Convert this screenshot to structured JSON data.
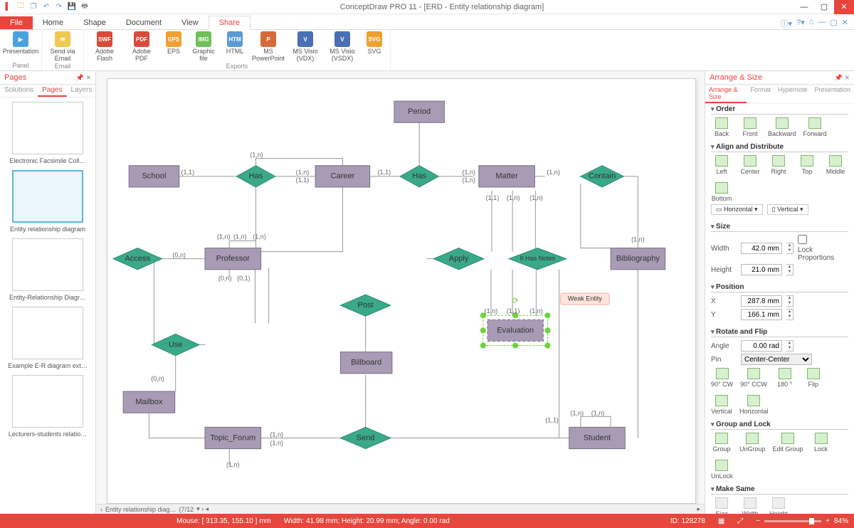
{
  "window": {
    "title": "ConceptDraw PRO 11 - [ERD - Entity relationship diagram]"
  },
  "ribbon": {
    "tabs": {
      "file": "File",
      "home": "Home",
      "shape": "Shape",
      "document": "Document",
      "view": "View",
      "share": "Share"
    },
    "groups": {
      "panel": {
        "label": "Panel",
        "presentation": "Presentation"
      },
      "email": {
        "label": "Email",
        "send": "Send via Email"
      },
      "exports": {
        "label": "Exports",
        "flash": "Adobe Flash",
        "pdf": "Adobe PDF",
        "eps": "EPS",
        "gfile": "Graphic file",
        "html": "HTML",
        "ppt": "MS PowerPoint",
        "vdx": "MS Visio (VDX)",
        "vsdx": "MS Visio (VSDX)",
        "svg": "SVG"
      }
    }
  },
  "pages_panel": {
    "title": "Pages",
    "tabs": {
      "solutions": "Solutions",
      "pages": "Pages",
      "layers": "Layers"
    },
    "thumbs": [
      "Electronic Facsimile Coll…",
      "Entity relationship diagram",
      "Entity-Relationship Diagr…",
      "Example E-R diagram ext…",
      "Lecturers-students relatio…"
    ]
  },
  "diagram": {
    "entities": {
      "period": "Period",
      "school": "School",
      "career": "Career",
      "matter": "Matter",
      "bibliography": "Bibliography",
      "professor": "Professor",
      "evaluation": "Evaluation",
      "billboard": "Billboard",
      "mailbox": "Mailbox",
      "topic_forum": "Topic_Forum",
      "student": "Student"
    },
    "relationships": {
      "has1": "Has",
      "has2": "Has",
      "contain": "Contain",
      "access": "Access",
      "apply": "Apply",
      "ithasnotes": "It Has Notes",
      "use": "Use",
      "post": "Post",
      "send": "Send"
    },
    "tooltip": "Weak Entity",
    "cardinalities": {
      "c11": "(1,1)",
      "c1n": "(1,n)",
      "c0n": "(0,n)",
      "c01": "(0,1)"
    }
  },
  "doc_tabs": {
    "page_label": "Entity relationship diag…",
    "page_counter": "(7/12"
  },
  "arrange": {
    "title": "Arrange & Size",
    "tabs": {
      "arrange": "Arrange & Size",
      "format": "Format",
      "hypernote": "Hypernote",
      "presentation": "Presentation"
    },
    "order": {
      "title": "Order",
      "back": "Back",
      "front": "Front",
      "backward": "Backward",
      "forward": "Forward"
    },
    "align": {
      "title": "Align and Distribute",
      "left": "Left",
      "center": "Center",
      "right": "Right",
      "top": "Top",
      "middle": "Middle",
      "bottom": "Bottom",
      "horizontal": "Horizontal",
      "vertical": "Vertical"
    },
    "size": {
      "title": "Size",
      "width_l": "Width",
      "height_l": "Height",
      "width": "42.0 mm",
      "height": "21.0 mm",
      "lock": "Lock Proportions"
    },
    "position": {
      "title": "Position",
      "x_l": "X",
      "y_l": "Y",
      "x": "287.8 mm",
      "y": "166.1 mm"
    },
    "rotate": {
      "title": "Rotate and Flip",
      "angle_l": "Angle",
      "angle": "0.00 rad",
      "pin_l": "Pin",
      "pin": "Center-Center",
      "cw": "90° CW",
      "ccw": "90° CCW",
      "deg180": "180 °",
      "flip": "Flip",
      "vertical": "Vertical",
      "horizontal": "Horizontal"
    },
    "group": {
      "title": "Group and Lock",
      "group": "Group",
      "ungroup": "UnGroup",
      "edit": "Edit Group",
      "lock": "Lock",
      "unlock": "UnLock"
    },
    "same": {
      "title": "Make Same",
      "size": "Size",
      "width": "Width",
      "height": "Height"
    }
  },
  "status": {
    "mouse": "Mouse: [ 313.35, 155.10 ] mm",
    "dims": "Width: 41.98 mm;  Height: 20.99 mm;  Angle: 0.00 rad",
    "id": "ID: 128278",
    "zoom": "84%"
  }
}
